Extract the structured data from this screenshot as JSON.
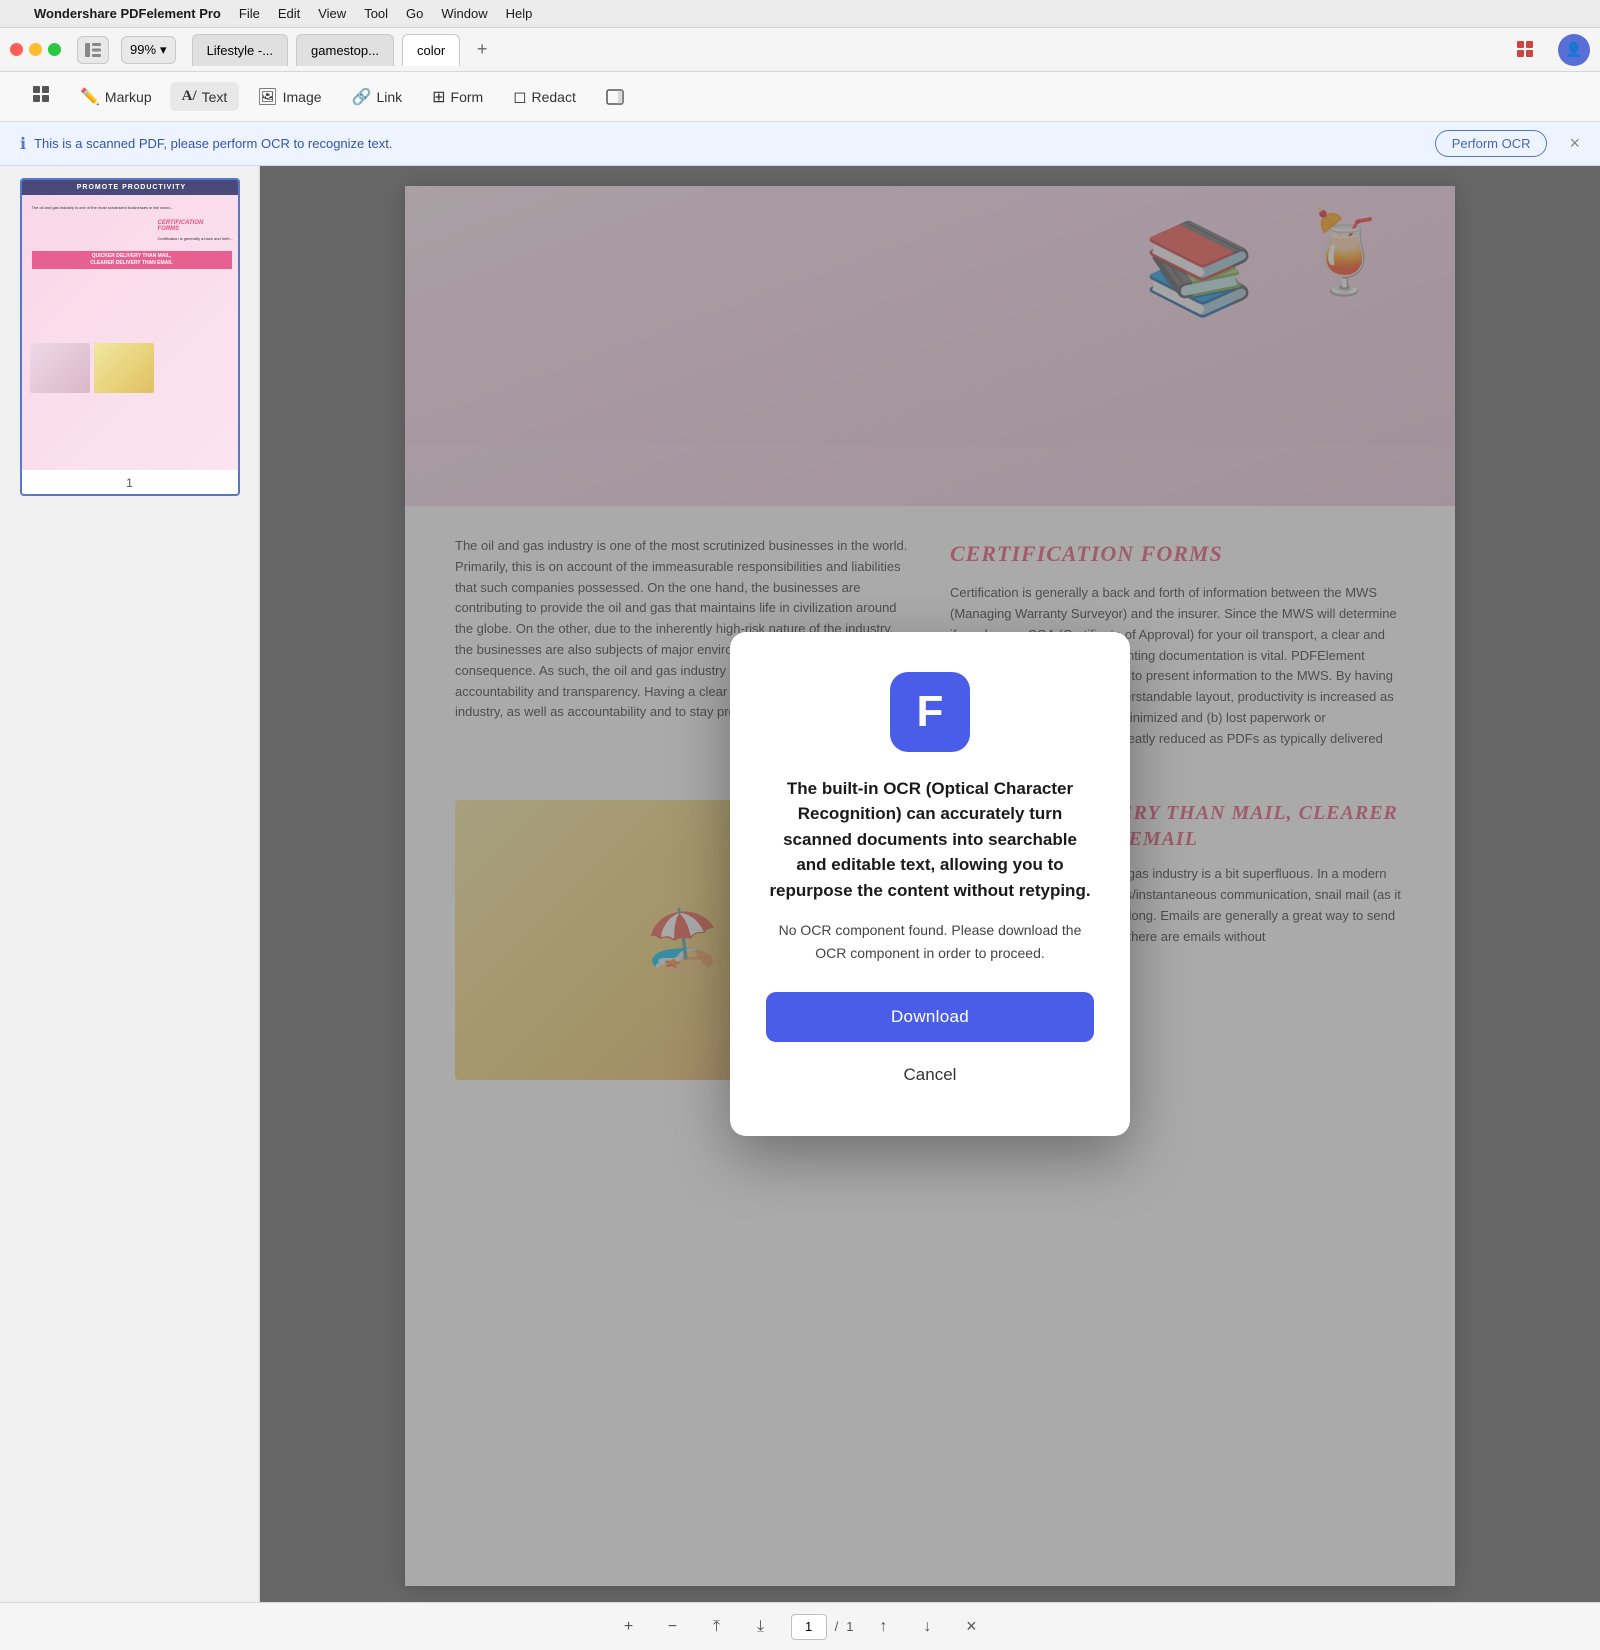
{
  "menubar": {
    "apple": "",
    "app_name": "Wondershare PDFelement Pro",
    "items": [
      "File",
      "Edit",
      "View",
      "Tool",
      "Go",
      "Window",
      "Help"
    ]
  },
  "titlebar": {
    "zoom_level": "99%",
    "tabs": [
      {
        "label": "Lifestyle -...",
        "active": false
      },
      {
        "label": "gamestop...",
        "active": false
      },
      {
        "label": "color",
        "active": true
      }
    ]
  },
  "toolbar": {
    "buttons": [
      {
        "label": "Markup",
        "icon": "✏️"
      },
      {
        "label": "Text",
        "icon": "A"
      },
      {
        "label": "Image",
        "icon": "🖼"
      },
      {
        "label": "Link",
        "icon": "🔗"
      },
      {
        "label": "Form",
        "icon": "⊞"
      },
      {
        "label": "Redact",
        "icon": "◻"
      },
      {
        "label": "",
        "icon": "⊟"
      }
    ]
  },
  "ocr_notice": {
    "message": "This is a scanned PDF, please perform OCR to recognize text.",
    "button_label": "Perform OCR"
  },
  "pdf": {
    "page_number": "1",
    "total_pages": "1",
    "header_text": "PROMOTE PRODUCTIVITY",
    "left_text": "The oil and gas industry is one of the most scrutinized businesses in the world. Primarily, this is on account of the immeasurable responsibilities and liabilities that such companies possessed. On the one hand, the businesses are contributing to provide the oil and gas that maintains life in civilization around the globe. On the other, due to the inherently high-risk nature of the industry, the businesses are also subjects of major environmental and safety consequence. As such, the oil and gas industry is faced with the notion of accountability and transparency. Having a clear definitive role within the industry, as well as accountability and to stay productive for the industry.",
    "section1_title": "CERTIFICATION FORMS",
    "section1_text": "Certification is generally a back and forth of information between the MWS (Managing Warranty Surveyor) and the insurer. Since the MWS will determine if you have a COA (Certificate of Approval) for your oil transport, a clear and concise methodology for presenting documentation is vital. PDFElement provides a quick and clear way to present information to the MWS. By having the information in an easy understandable layout, productivity is increased as (a) the need to re-do tasks is minimized and (b) lost paperwork or misunderstood paperwork is greatly reduced as PDFs as typically delivered digitally.",
    "section2_title": "QUICKER DELIVERY THAN MAIL, CLEARER DELIVERY THAN EMAIL",
    "section2_text": "Sending mail in the oil and the gas industry is a bit superfluous. In a modern world of digital media and mass/instantaneous communication, snail mail (as it is commonly referred) takes to long. Emails are generally a great way to send information to the industry, but there are emails without"
  },
  "modal": {
    "icon": "F",
    "title": "The built-in OCR (Optical Character Recognition) can accurately turn scanned documents into searchable and editable text, allowing you to repurpose the content without retyping.",
    "description": "No OCR component found. Please download the OCR component in order to proceed.",
    "download_label": "Download",
    "cancel_label": "Cancel"
  },
  "bottom_bar": {
    "page_current": "1",
    "page_separator": "/",
    "page_total": "1"
  },
  "colors": {
    "accent_blue": "#4a5de8",
    "accent_pink": "#e8507a",
    "ocr_border": "#5577cc",
    "tab_active_bg": "#ffffff"
  }
}
